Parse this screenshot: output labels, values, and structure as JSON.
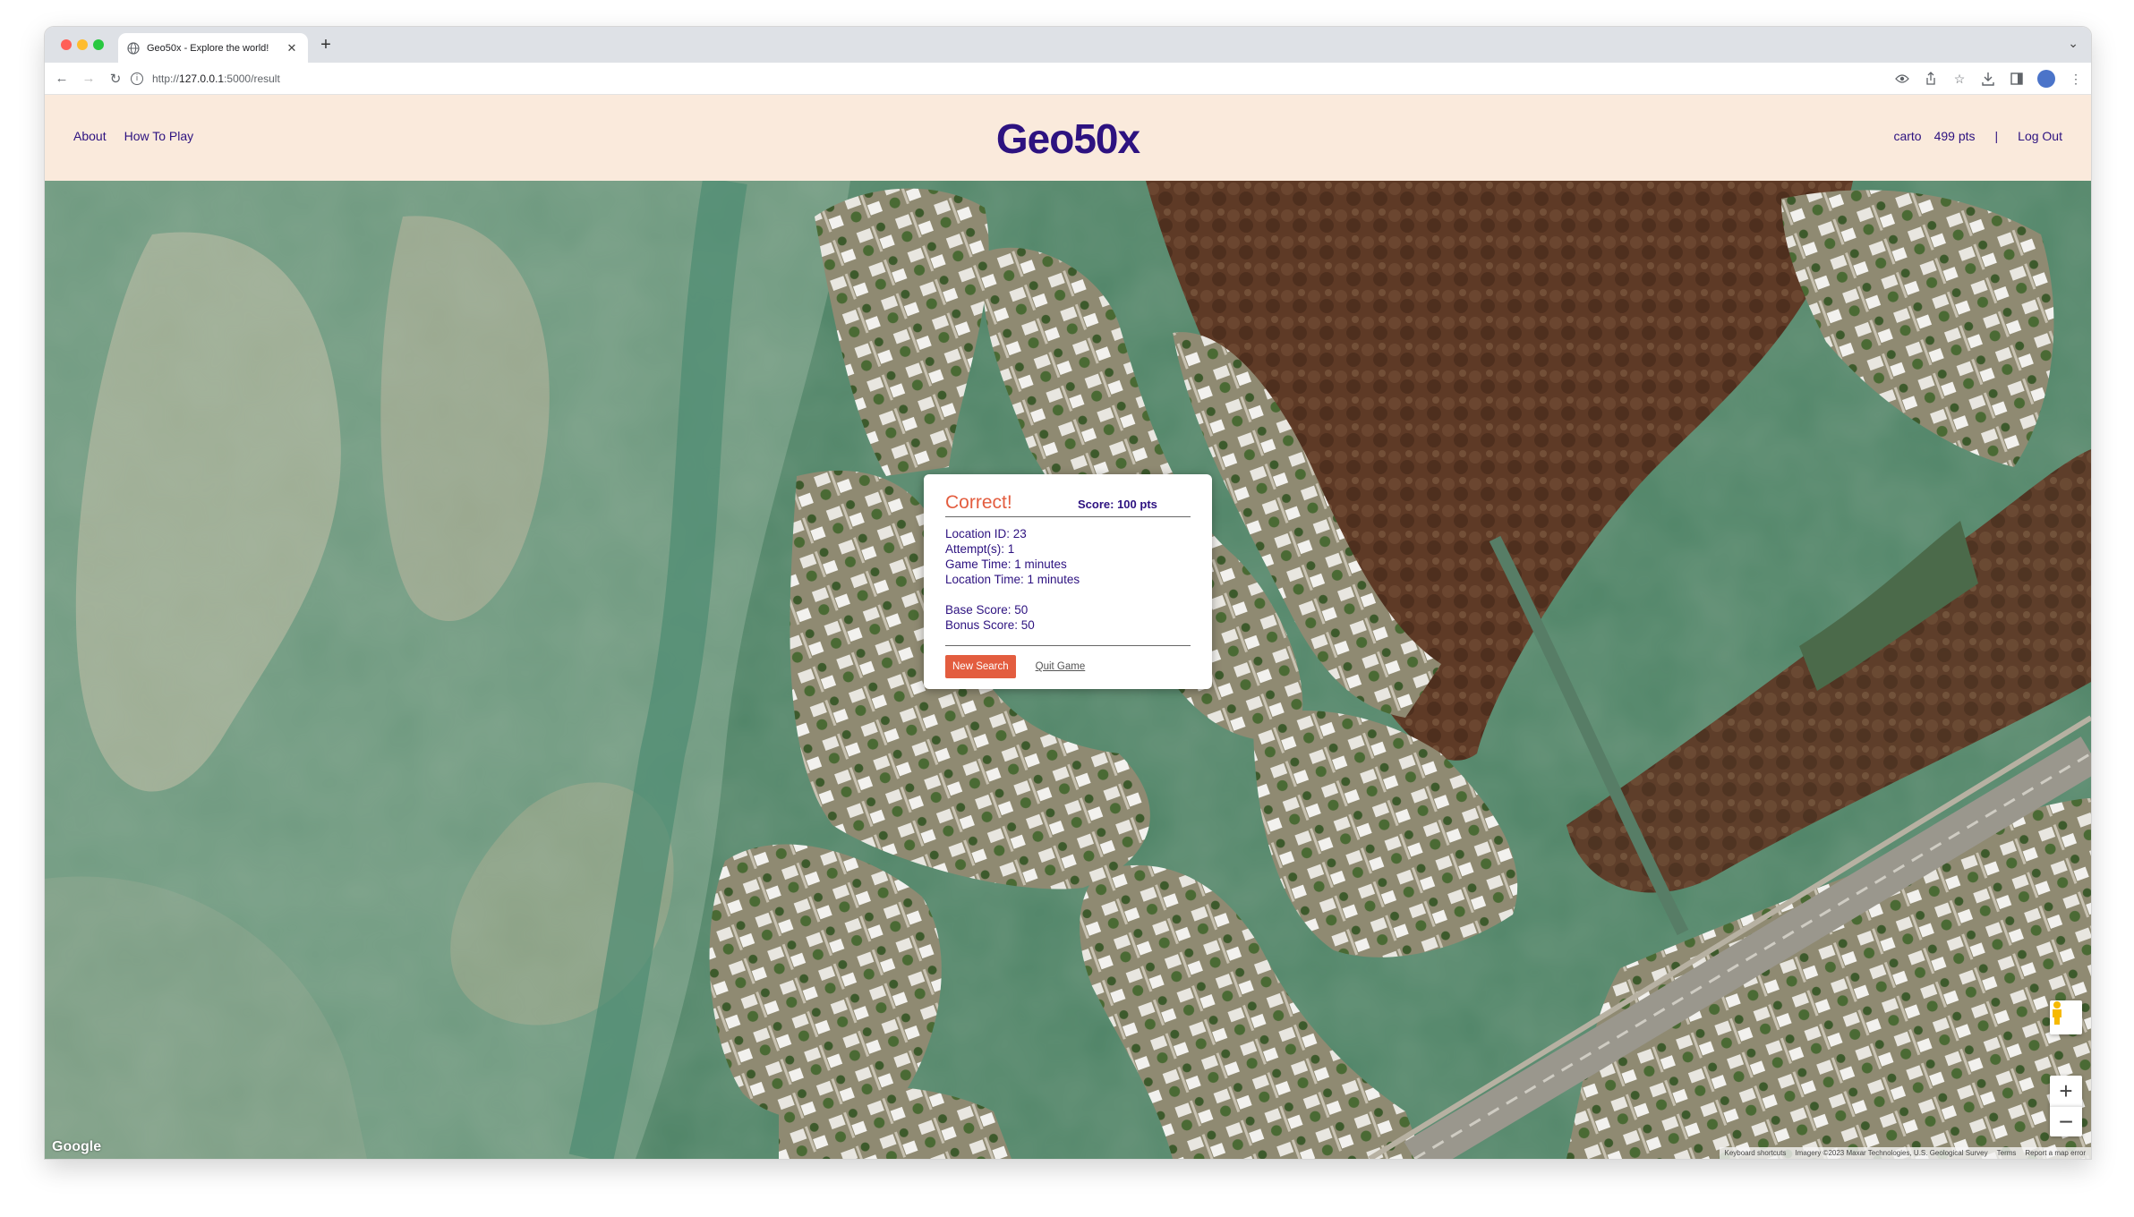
{
  "browser": {
    "tab_title": "Geo50x - Explore the world!",
    "url_scheme": "http://",
    "url_host": "127.0.0.1",
    "url_path": ":5000/result"
  },
  "header": {
    "nav_left": [
      "About",
      "How To Play"
    ],
    "logo": "Geo50x",
    "username": "carto",
    "points": "499 pts",
    "separator": "|",
    "logout": "Log Out"
  },
  "result_card": {
    "result": "Correct!",
    "score": "Score: 100 pts",
    "location_id": "Location ID: 23",
    "attempts": "Attempt(s): 1",
    "game_time": "Game Time: 1 minutes",
    "location_time": "Location Time: 1 minutes",
    "base_score": "Base Score: 50",
    "bonus_score": "Bonus Score: 50",
    "new_search": "New Search",
    "quit_game": "Quit Game"
  },
  "map": {
    "zoom_in": "+",
    "zoom_out": "−",
    "google_logo": "Google",
    "keyboard_shortcuts": "Keyboard shortcuts",
    "imagery": "Imagery ©2023 Maxar Technologies, U.S. Geological Survey",
    "terms": "Terms",
    "report": "Report a map error"
  },
  "colors": {
    "brand": "#2d1280",
    "accent": "#e35d3f",
    "header_bg": "#faeadc"
  }
}
